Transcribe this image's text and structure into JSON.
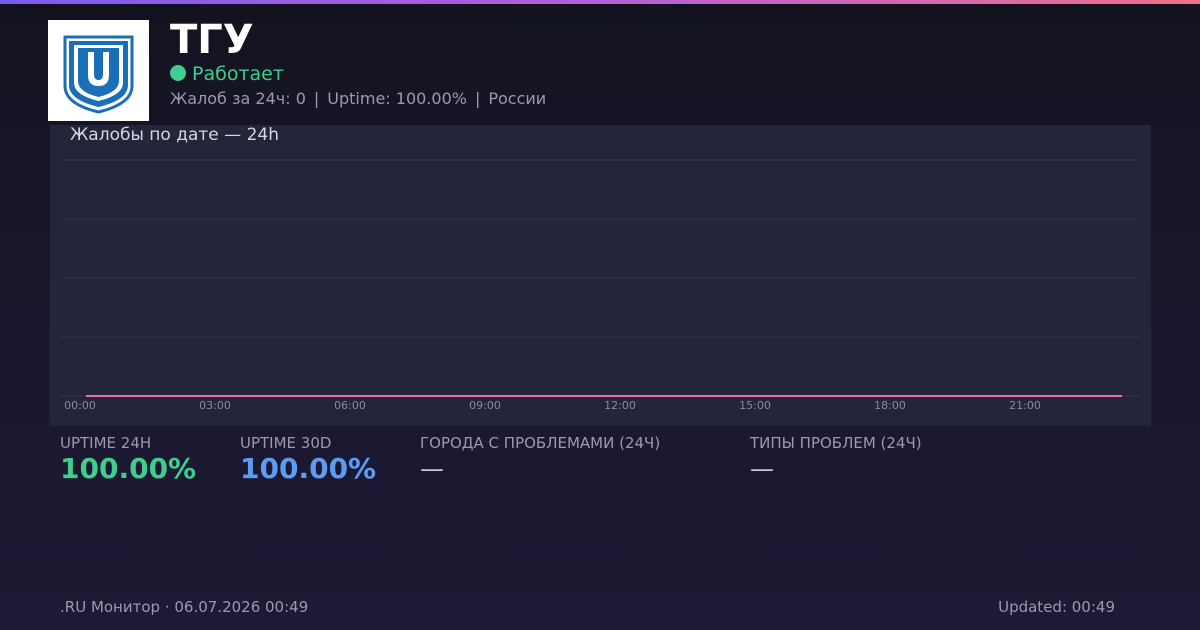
{
  "header": {
    "title": "ТГУ",
    "status_text": "Работает",
    "status_color": "#3ecf8e",
    "meta": {
      "complaints": "Жалоб за 24ч: 0",
      "uptime": "Uptime: 100.00%",
      "region": "России",
      "separator": "|"
    },
    "logo_icon": "university-shield-logo"
  },
  "chart": {
    "title": "Жалобы по дате — 24h"
  },
  "chart_data": {
    "type": "line",
    "x": [
      "00:00",
      "03:00",
      "06:00",
      "09:00",
      "12:00",
      "15:00",
      "18:00",
      "21:00"
    ],
    "tick_labels": [
      "00:00",
      "03:00",
      "06:00",
      "09:00",
      "12:00",
      "15:00",
      "18:00",
      "21:00"
    ],
    "series": [
      {
        "values": [
          0,
          0,
          0,
          0,
          0,
          0,
          0,
          0
        ],
        "color": "#e070b0"
      }
    ],
    "grid": true,
    "title": "Жалобы по дате — 24h"
  },
  "stats": [
    {
      "label": "UPTIME 24H",
      "value": "100.00%",
      "color": "#3ecf8e"
    },
    {
      "label": "UPTIME 30D",
      "value": "100.00%",
      "color": "#5b9df5"
    },
    {
      "label": "ГОРОДА С ПРОБЛЕМАМИ (24Ч)",
      "value": "—",
      "color": "#c8c8d8"
    },
    {
      "label": "ТИПЫ ПРОБЛЕМ (24Ч)",
      "value": "—",
      "color": "#c8c8d8"
    }
  ],
  "footer": {
    "left": ".RU Монитор · 06.07.2026 00:49",
    "right": "Updated: 00:49"
  },
  "colors": {
    "accent_gradient_start": "#7b5cf0",
    "accent_gradient_end": "#f0708a",
    "panel_bg": "#24253a",
    "grid_line": "#34354a"
  }
}
